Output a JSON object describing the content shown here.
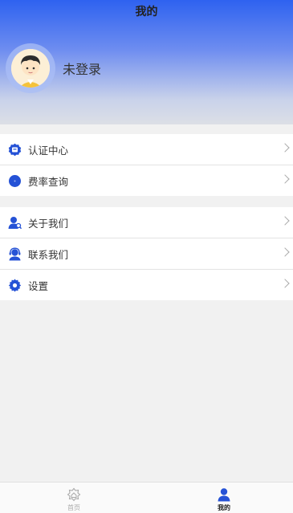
{
  "page": {
    "title": "我的"
  },
  "profile": {
    "name": "未登录",
    "avatar": "avatar-icon"
  },
  "menu": {
    "group1": [
      {
        "label": "认证中心",
        "icon": "badge-icon"
      },
      {
        "label": "费率查询",
        "icon": "coin-icon"
      }
    ],
    "group2": [
      {
        "label": "关于我们",
        "icon": "user-search-icon"
      },
      {
        "label": "联系我们",
        "icon": "headset-icon"
      },
      {
        "label": "设置",
        "icon": "gear-icon"
      }
    ]
  },
  "tabbar": {
    "home": {
      "label": "首页",
      "icon": "home-icon"
    },
    "mine": {
      "label": "我的",
      "icon": "person-icon"
    }
  },
  "colors": {
    "accent": "#2552d6",
    "header_top": "#2e62f0",
    "header_bottom": "#dcdfe6",
    "background": "#f1f1f1"
  }
}
